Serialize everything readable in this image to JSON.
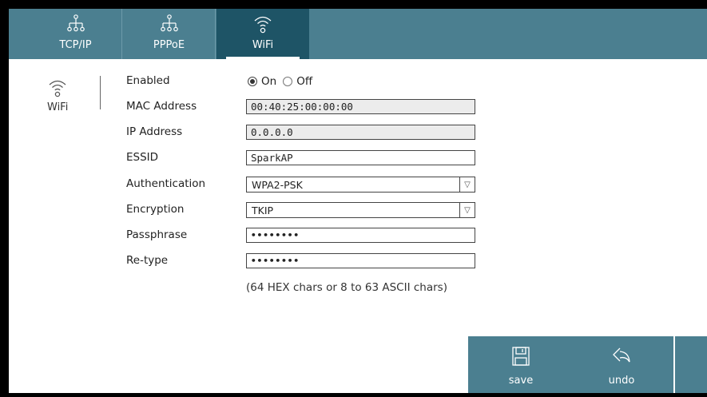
{
  "tabs": [
    {
      "label": "TCP/IP",
      "icon": "network-icon",
      "active": false
    },
    {
      "label": "PPPoE",
      "icon": "network-icon",
      "active": false
    },
    {
      "label": "WiFi",
      "icon": "wifi-icon",
      "active": true
    }
  ],
  "sidebar": {
    "label": "WiFi",
    "icon": "wifi-icon"
  },
  "form": {
    "enabled": {
      "label": "Enabled",
      "options": [
        "On",
        "Off"
      ],
      "selected": "On"
    },
    "mac": {
      "label": "MAC Address",
      "value": "00:40:25:00:00:00"
    },
    "ip": {
      "label": "IP Address",
      "value": "0.0.0.0"
    },
    "essid": {
      "label": "ESSID",
      "value": "SparkAP"
    },
    "auth": {
      "label": "Authentication",
      "value": "WPA2-PSK"
    },
    "encryption": {
      "label": "Encryption",
      "value": "TKIP"
    },
    "passphrase": {
      "label": "Passphrase",
      "value": "••••••••"
    },
    "retype": {
      "label": "Re-type",
      "value": "••••••••"
    },
    "hint": "(64 HEX chars or 8 to 63 ASCII chars)"
  },
  "actions": {
    "save": "save",
    "undo": "undo"
  },
  "colors": {
    "bar": "#4b7f90",
    "active_tab": "#1e5466"
  }
}
